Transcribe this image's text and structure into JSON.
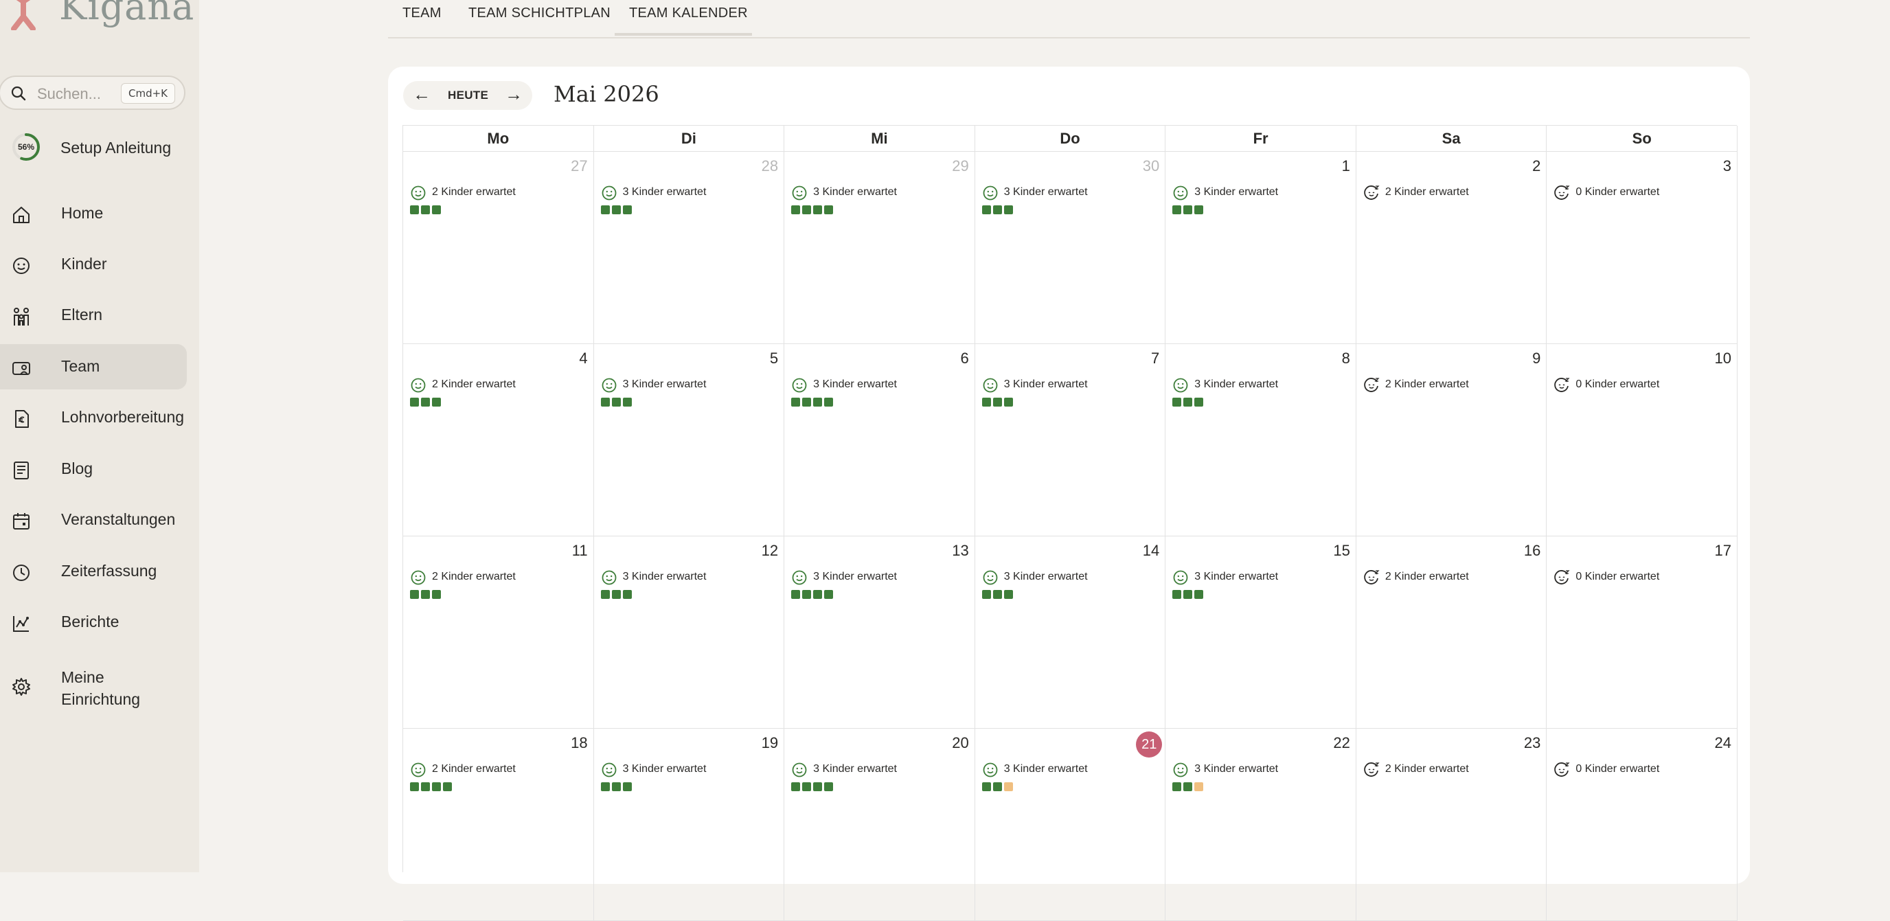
{
  "app": {
    "logo_text": "Kigana",
    "brand_color": "#c75f74",
    "accent_green": "#3e7e3a"
  },
  "sidebar": {
    "search": {
      "placeholder": "Suchen...",
      "shortcut": "Cmd+K"
    },
    "setup": {
      "progress_label": "56%",
      "progress": 0.56,
      "label": "Setup Anleitung"
    },
    "items": [
      {
        "label": "Home",
        "icon": "home-icon"
      },
      {
        "label": "Kinder",
        "icon": "child-face-icon"
      },
      {
        "label": "Eltern",
        "icon": "parents-icon"
      },
      {
        "label": "Team",
        "icon": "team-icon",
        "active": true
      },
      {
        "label": "Lohnvorbereitung",
        "icon": "payroll-icon"
      },
      {
        "label": "Blog",
        "icon": "blog-icon"
      },
      {
        "label": "Veranstaltungen",
        "icon": "calendar-icon"
      },
      {
        "label": "Zeiterfassung",
        "icon": "clock-icon"
      },
      {
        "label": "Berichte",
        "icon": "chart-icon"
      },
      {
        "label": "Meine Einrichtung",
        "icon": "gear-icon"
      }
    ]
  },
  "tabs": [
    {
      "label": "TEAM"
    },
    {
      "label": "TEAM SCHICHTPLAN"
    },
    {
      "label": "TEAM KALENDER",
      "active": true
    }
  ],
  "calendar": {
    "today_label": "HEUTE",
    "prev_label": "←",
    "next_label": "→",
    "month_title": "Mai 2026",
    "weekdays": [
      "Mo",
      "Di",
      "Mi",
      "Do",
      "Fr",
      "Sa",
      "So"
    ],
    "weeks": [
      [
        {
          "day": "27",
          "muted": true,
          "expected": "2 Kinder erwartet",
          "staff": 3,
          "warn": 0,
          "icon": "smile-icon"
        },
        {
          "day": "28",
          "muted": true,
          "expected": "3 Kinder erwartet",
          "staff": 3,
          "warn": 0,
          "icon": "smile-icon"
        },
        {
          "day": "29",
          "muted": true,
          "expected": "3 Kinder erwartet",
          "staff": 4,
          "warn": 0,
          "icon": "smile-icon"
        },
        {
          "day": "30",
          "muted": true,
          "expected": "3 Kinder erwartet",
          "staff": 3,
          "warn": 0,
          "icon": "smile-icon"
        },
        {
          "day": "1",
          "expected": "3 Kinder erwartet",
          "staff": 3,
          "warn": 0,
          "icon": "smile-icon"
        },
        {
          "day": "2",
          "expected": "2 Kinder erwartet",
          "staff": 0,
          "warn": 0,
          "icon": "sleep-face-icon"
        },
        {
          "day": "3",
          "expected": "0 Kinder erwartet",
          "staff": 0,
          "warn": 0,
          "icon": "sleep-face-icon"
        }
      ],
      [
        {
          "day": "4",
          "expected": "2 Kinder erwartet",
          "staff": 3,
          "warn": 0,
          "icon": "smile-icon"
        },
        {
          "day": "5",
          "expected": "3 Kinder erwartet",
          "staff": 3,
          "warn": 0,
          "icon": "smile-icon"
        },
        {
          "day": "6",
          "expected": "3 Kinder erwartet",
          "staff": 4,
          "warn": 0,
          "icon": "smile-icon"
        },
        {
          "day": "7",
          "expected": "3 Kinder erwartet",
          "staff": 3,
          "warn": 0,
          "icon": "smile-icon"
        },
        {
          "day": "8",
          "expected": "3 Kinder erwartet",
          "staff": 3,
          "warn": 0,
          "icon": "smile-icon"
        },
        {
          "day": "9",
          "expected": "2 Kinder erwartet",
          "staff": 0,
          "warn": 0,
          "icon": "sleep-face-icon"
        },
        {
          "day": "10",
          "expected": "0 Kinder erwartet",
          "staff": 0,
          "warn": 0,
          "icon": "sleep-face-icon"
        }
      ],
      [
        {
          "day": "11",
          "expected": "2 Kinder erwartet",
          "staff": 3,
          "warn": 0,
          "icon": "smile-icon"
        },
        {
          "day": "12",
          "expected": "3 Kinder erwartet",
          "staff": 3,
          "warn": 0,
          "icon": "smile-icon"
        },
        {
          "day": "13",
          "expected": "3 Kinder erwartet",
          "staff": 4,
          "warn": 0,
          "icon": "smile-icon"
        },
        {
          "day": "14",
          "expected": "3 Kinder erwartet",
          "staff": 3,
          "warn": 0,
          "icon": "smile-icon"
        },
        {
          "day": "15",
          "expected": "3 Kinder erwartet",
          "staff": 3,
          "warn": 0,
          "icon": "smile-icon"
        },
        {
          "day": "16",
          "expected": "2 Kinder erwartet",
          "staff": 0,
          "warn": 0,
          "icon": "sleep-face-icon"
        },
        {
          "day": "17",
          "expected": "0 Kinder erwartet",
          "staff": 0,
          "warn": 0,
          "icon": "sleep-face-icon"
        }
      ],
      [
        {
          "day": "18",
          "expected": "2 Kinder erwartet",
          "staff": 4,
          "warn": 0,
          "icon": "smile-icon"
        },
        {
          "day": "19",
          "expected": "3 Kinder erwartet",
          "staff": 3,
          "warn": 0,
          "icon": "smile-icon"
        },
        {
          "day": "20",
          "expected": "3 Kinder erwartet",
          "staff": 4,
          "warn": 0,
          "icon": "smile-icon"
        },
        {
          "day": "21",
          "today": true,
          "expected": "3 Kinder erwartet",
          "staff": 2,
          "warn": 1,
          "icon": "smile-icon"
        },
        {
          "day": "22",
          "expected": "3 Kinder erwartet",
          "staff": 2,
          "warn": 1,
          "icon": "smile-icon"
        },
        {
          "day": "23",
          "expected": "2 Kinder erwartet",
          "staff": 0,
          "warn": 0,
          "icon": "sleep-face-icon"
        },
        {
          "day": "24",
          "expected": "0 Kinder erwartet",
          "staff": 0,
          "warn": 0,
          "icon": "sleep-face-icon"
        }
      ]
    ]
  }
}
